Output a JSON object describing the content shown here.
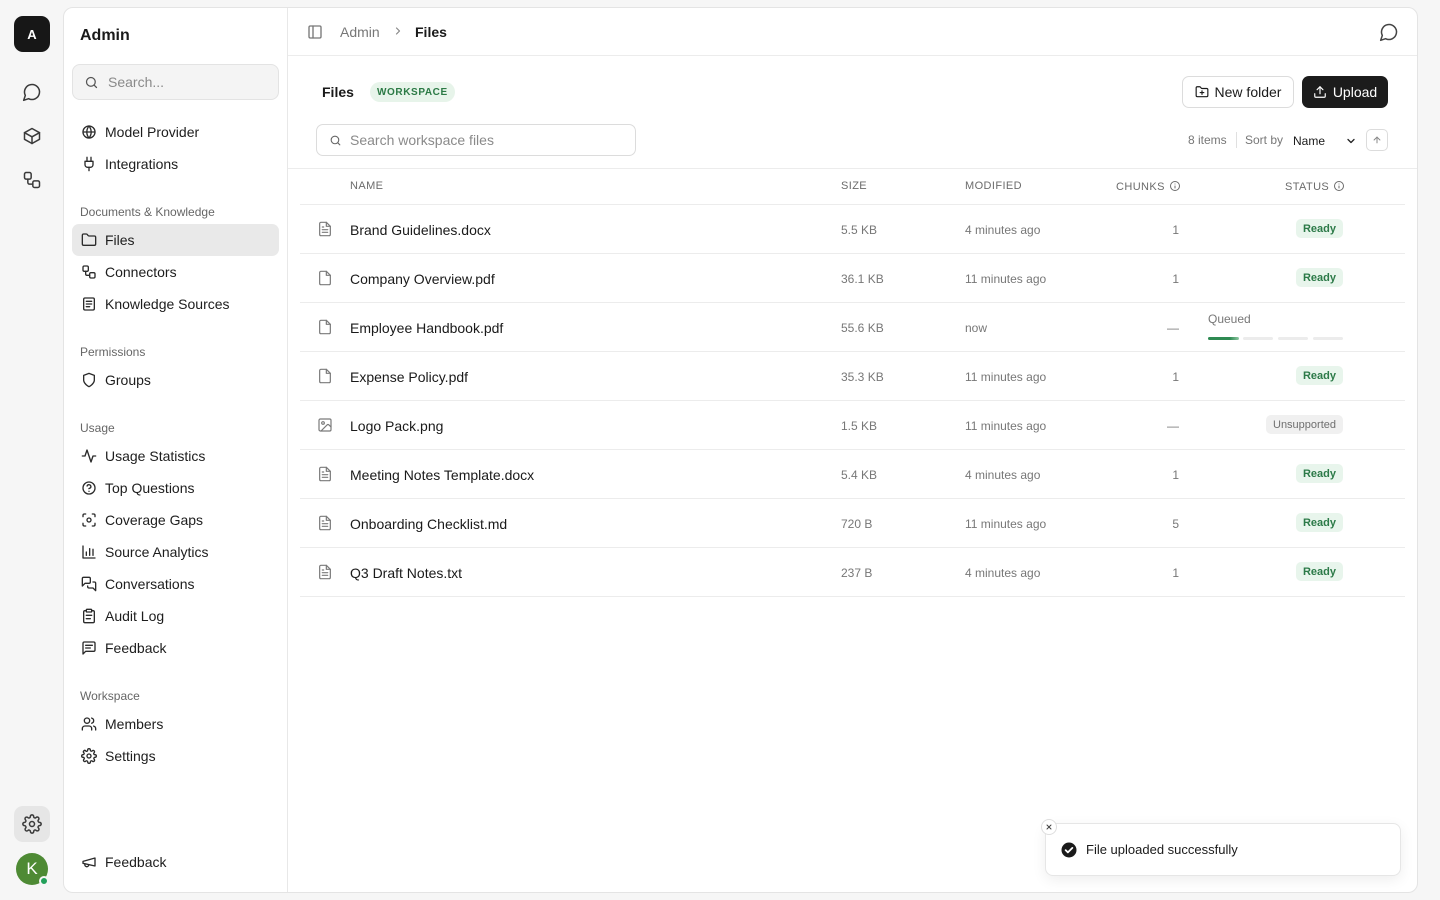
{
  "workspace": {
    "initial": "A"
  },
  "user": {
    "initial": "K",
    "avatar_color": "#4e8a34",
    "online_color": "#22a05a"
  },
  "rail": [
    {
      "icon": "chat-icon"
    },
    {
      "icon": "cube-icon"
    },
    {
      "icon": "workflow-icon"
    },
    {
      "icon": "gear-icon",
      "active": true
    }
  ],
  "sidebar": {
    "title": "Admin",
    "search_placeholder": "Search...",
    "top_items": [
      {
        "label": "Model Provider",
        "icon": "globe-icon"
      },
      {
        "label": "Integrations",
        "icon": "plug-icon"
      }
    ],
    "sections": [
      {
        "title": "Documents & Knowledge",
        "items": [
          {
            "label": "Files",
            "icon": "folder-icon",
            "active": true
          },
          {
            "label": "Connectors",
            "icon": "connectors-icon"
          },
          {
            "label": "Knowledge Sources",
            "icon": "book-icon"
          }
        ]
      },
      {
        "title": "Permissions",
        "items": [
          {
            "label": "Groups",
            "icon": "shield-icon"
          }
        ]
      },
      {
        "title": "Usage",
        "items": [
          {
            "label": "Usage Statistics",
            "icon": "activity-icon"
          },
          {
            "label": "Top Questions",
            "icon": "help-circle-icon"
          },
          {
            "label": "Coverage Gaps",
            "icon": "scan-icon"
          },
          {
            "label": "Source Analytics",
            "icon": "bar-chart-icon"
          },
          {
            "label": "Conversations",
            "icon": "messages-icon"
          },
          {
            "label": "Audit Log",
            "icon": "clipboard-icon"
          },
          {
            "label": "Feedback",
            "icon": "message-square-text-icon"
          }
        ]
      },
      {
        "title": "Workspace",
        "items": [
          {
            "label": "Members",
            "icon": "users-icon"
          },
          {
            "label": "Settings",
            "icon": "settings-icon"
          }
        ]
      }
    ],
    "footer_item": {
      "label": "Feedback",
      "icon": "megaphone-icon"
    }
  },
  "topbar": {
    "crumbs": [
      "Admin",
      "Files"
    ]
  },
  "page": {
    "title": "Files",
    "badge": "WORKSPACE",
    "new_folder_label": "New folder",
    "upload_label": "Upload",
    "search_placeholder": "Search workspace files",
    "items_count": "8 items",
    "sort_by_label": "Sort by",
    "sort_value": "Name",
    "sort_options": [
      "Name"
    ]
  },
  "table": {
    "columns": {
      "name": "NAME",
      "size": "SIZE",
      "modified": "MODIFIED",
      "chunks": "CHUNKS",
      "status": "STATUS"
    },
    "rows": [
      {
        "icon": "document-text-icon",
        "name": "Brand Guidelines.docx",
        "size": "5.5 KB",
        "modified": "4 minutes ago",
        "chunks": "1",
        "status": "Ready",
        "status_kind": "ready"
      },
      {
        "icon": "file-icon",
        "name": "Company Overview.pdf",
        "size": "36.1 KB",
        "modified": "11 minutes ago",
        "chunks": "1",
        "status": "Ready",
        "status_kind": "ready"
      },
      {
        "icon": "file-icon",
        "name": "Employee Handbook.pdf",
        "size": "55.6 KB",
        "modified": "now",
        "chunks": "—",
        "status": "Queued",
        "status_kind": "queued",
        "progress": 0.23
      },
      {
        "icon": "file-icon",
        "name": "Expense Policy.pdf",
        "size": "35.3 KB",
        "modified": "11 minutes ago",
        "chunks": "1",
        "status": "Ready",
        "status_kind": "ready"
      },
      {
        "icon": "image-icon",
        "name": "Logo Pack.png",
        "size": "1.5 KB",
        "modified": "11 minutes ago",
        "chunks": "—",
        "status": "Unsupported",
        "status_kind": "unsupported"
      },
      {
        "icon": "document-text-icon",
        "name": "Meeting Notes Template.docx",
        "size": "5.4 KB",
        "modified": "4 minutes ago",
        "chunks": "1",
        "status": "Ready",
        "status_kind": "ready"
      },
      {
        "icon": "document-text-icon",
        "name": "Onboarding Checklist.md",
        "size": "720 B",
        "modified": "11 minutes ago",
        "chunks": "5",
        "status": "Ready",
        "status_kind": "ready"
      },
      {
        "icon": "document-text-icon",
        "name": "Q3 Draft Notes.txt",
        "size": "237 B",
        "modified": "4 minutes ago",
        "chunks": "1",
        "status": "Ready",
        "status_kind": "ready"
      }
    ]
  },
  "toast": {
    "message": "File uploaded successfully"
  },
  "colors": {
    "accent": "#1c1c1c",
    "ready_bg": "#e8f5ec",
    "ready_fg": "#2c7a48",
    "badge_bg": "#e7f4ea",
    "badge_fg": "#2b7a45",
    "progress": "#2e8a52"
  }
}
